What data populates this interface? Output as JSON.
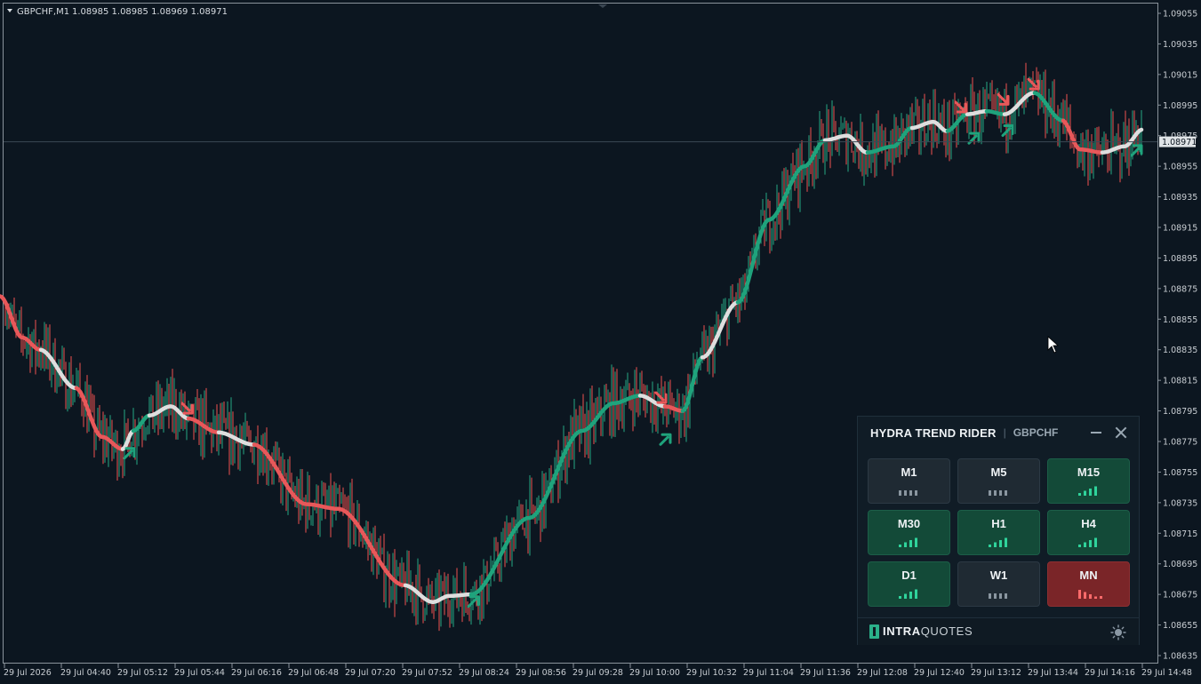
{
  "chart_header": {
    "symbol": "GBPCHF,M1",
    "ohlc": "1.08985 1.08985 1.08969 1.08971"
  },
  "current_price": "1.08971",
  "colors": {
    "background": "#0c1620",
    "bull": "#1fa37c",
    "bear": "#e8585a",
    "neutral": "#dedede",
    "candle_up": "#26a883",
    "candle_down": "#ef5350"
  },
  "chart_data": {
    "type": "line",
    "y_tick_labels": [
      "1.09055",
      "1.09035",
      "1.09015",
      "1.08995",
      "1.08975",
      "1.08955",
      "1.08935",
      "1.08915",
      "1.08895",
      "1.08875",
      "1.08855",
      "1.08835",
      "1.08815",
      "1.08795",
      "1.08775",
      "1.08755",
      "1.08735",
      "1.08715",
      "1.08695",
      "1.08675",
      "1.08655",
      "1.08635"
    ],
    "x_tick_labels": [
      "29 Jul 2026",
      "29 Jul 04:40",
      "29 Jul 05:12",
      "29 Jul 05:44",
      "29 Jul 06:16",
      "29 Jul 06:48",
      "29 Jul 07:20",
      "29 Jul 07:52",
      "29 Jul 08:24",
      "29 Jul 08:56",
      "29 Jul 09:28",
      "29 Jul 10:00",
      "29 Jul 10:32",
      "29 Jul 11:04",
      "29 Jul 11:36",
      "29 Jul 12:08",
      "29 Jul 12:40",
      "29 Jul 13:12",
      "29 Jul 13:44",
      "29 Jul 14:16",
      "29 Jul 14:48"
    ],
    "ylim": [
      1.08625,
      1.0906
    ],
    "trend_line": [
      {
        "x": 0,
        "y": 1.0887,
        "trend": "bear"
      },
      {
        "x": 25,
        "y": 1.08843,
        "trend": "bear"
      },
      {
        "x": 45,
        "y": 1.08835,
        "trend": "neutral"
      },
      {
        "x": 85,
        "y": 1.0881,
        "trend": "bear"
      },
      {
        "x": 115,
        "y": 1.08778,
        "trend": "bear"
      },
      {
        "x": 138,
        "y": 1.0877,
        "trend": "neutral"
      },
      {
        "x": 150,
        "y": 1.08782,
        "trend": "bull"
      },
      {
        "x": 168,
        "y": 1.08792,
        "trend": "neutral"
      },
      {
        "x": 192,
        "y": 1.08798,
        "trend": "neutral"
      },
      {
        "x": 212,
        "y": 1.0879,
        "trend": "bear"
      },
      {
        "x": 245,
        "y": 1.08781,
        "trend": "neutral"
      },
      {
        "x": 285,
        "y": 1.08773,
        "trend": "bear"
      },
      {
        "x": 345,
        "y": 1.08734,
        "trend": "bear"
      },
      {
        "x": 380,
        "y": 1.08731,
        "trend": "bear"
      },
      {
        "x": 455,
        "y": 1.08681,
        "trend": "neutral"
      },
      {
        "x": 487,
        "y": 1.0867,
        "trend": "neutral"
      },
      {
        "x": 505,
        "y": 1.08674,
        "trend": "neutral"
      },
      {
        "x": 530,
        "y": 1.08675,
        "trend": "bull"
      },
      {
        "x": 595,
        "y": 1.08725,
        "trend": "bull"
      },
      {
        "x": 655,
        "y": 1.08782,
        "trend": "bull"
      },
      {
        "x": 690,
        "y": 1.088,
        "trend": "bull"
      },
      {
        "x": 720,
        "y": 1.08805,
        "trend": "neutral"
      },
      {
        "x": 748,
        "y": 1.08798,
        "trend": "bear"
      },
      {
        "x": 768,
        "y": 1.08795,
        "trend": "bull"
      },
      {
        "x": 790,
        "y": 1.0883,
        "trend": "neutral"
      },
      {
        "x": 830,
        "y": 1.08866,
        "trend": "bull"
      },
      {
        "x": 865,
        "y": 1.0892,
        "trend": "bull"
      },
      {
        "x": 905,
        "y": 1.08955,
        "trend": "bull"
      },
      {
        "x": 928,
        "y": 1.08972,
        "trend": "neutral"
      },
      {
        "x": 953,
        "y": 1.08975,
        "trend": "neutral"
      },
      {
        "x": 975,
        "y": 1.08964,
        "trend": "bull"
      },
      {
        "x": 1005,
        "y": 1.08968,
        "trend": "bull"
      },
      {
        "x": 1025,
        "y": 1.0898,
        "trend": "neutral"
      },
      {
        "x": 1050,
        "y": 1.08984,
        "trend": "neutral"
      },
      {
        "x": 1065,
        "y": 1.08978,
        "trend": "bull"
      },
      {
        "x": 1088,
        "y": 1.08989,
        "trend": "neutral"
      },
      {
        "x": 1110,
        "y": 1.08991,
        "trend": "bull"
      },
      {
        "x": 1130,
        "y": 1.08989,
        "trend": "neutral"
      },
      {
        "x": 1163,
        "y": 1.09003,
        "trend": "bull"
      },
      {
        "x": 1195,
        "y": 1.08985,
        "trend": "bear"
      },
      {
        "x": 1215,
        "y": 1.08966,
        "trend": "bear"
      },
      {
        "x": 1240,
        "y": 1.08964,
        "trend": "neutral"
      },
      {
        "x": 1265,
        "y": 1.08968,
        "trend": "neutral"
      },
      {
        "x": 1285,
        "y": 1.08979,
        "trend": "bull"
      }
    ],
    "signals": [
      {
        "x": 145,
        "y": 1.08767,
        "dir": "buy"
      },
      {
        "x": 210,
        "y": 1.08797,
        "dir": "sell"
      },
      {
        "x": 532,
        "y": 1.0867,
        "dir": "buy"
      },
      {
        "x": 743,
        "y": 1.08804,
        "dir": "sell"
      },
      {
        "x": 748,
        "y": 1.08776,
        "dir": "buy"
      },
      {
        "x": 1080,
        "y": 1.08994,
        "dir": "sell"
      },
      {
        "x": 1095,
        "y": 1.08973,
        "dir": "buy"
      },
      {
        "x": 1128,
        "y": 1.08999,
        "dir": "sell"
      },
      {
        "x": 1133,
        "y": 1.08978,
        "dir": "buy"
      },
      {
        "x": 1162,
        "y": 1.09009,
        "dir": "sell"
      },
      {
        "x": 1278,
        "y": 1.08965,
        "dir": "buy"
      }
    ]
  },
  "panel": {
    "title": "HYDRA TREND RIDER",
    "separator": "|",
    "symbol": "GBPCHF",
    "brand_bold": "INTRA",
    "brand_rest": "QUOTES",
    "tiles": [
      {
        "label": "M1",
        "state": "neutral"
      },
      {
        "label": "M5",
        "state": "neutral"
      },
      {
        "label": "M15",
        "state": "bull"
      },
      {
        "label": "M30",
        "state": "bull"
      },
      {
        "label": "H1",
        "state": "bull"
      },
      {
        "label": "H4",
        "state": "bull"
      },
      {
        "label": "D1",
        "state": "bull"
      },
      {
        "label": "W1",
        "state": "neutral"
      },
      {
        "label": "MN",
        "state": "bear"
      }
    ]
  }
}
